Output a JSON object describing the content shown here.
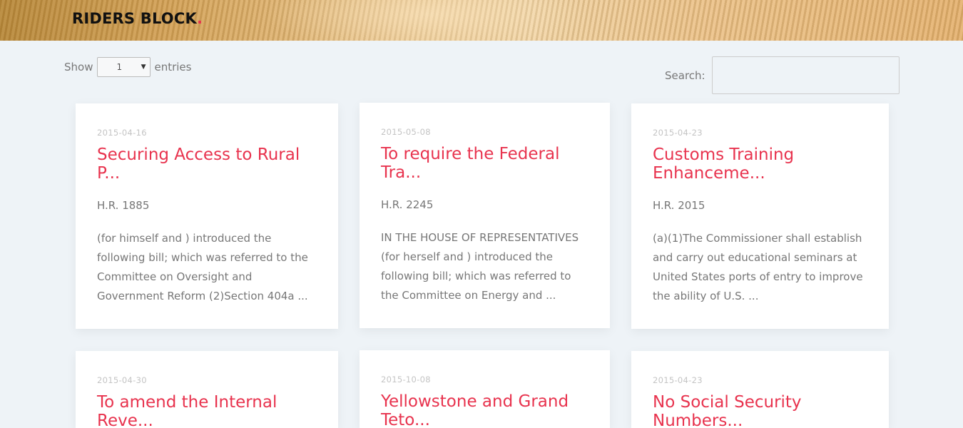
{
  "site": {
    "logo_text": "RIDERS BLOCK",
    "logo_dot": "."
  },
  "controls": {
    "show_label": "Show",
    "entries_value": "1",
    "entries_label": "entries",
    "search_label": "Search:",
    "search_value": ""
  },
  "cards": [
    {
      "date": "2015-04-16",
      "title": "Securing Access to Rural P...",
      "bill": "H.R. 1885",
      "excerpt": "(for himself and ) introduced the following bill; which was referred to the Committee on Oversight and Government Reform (2)Section 404a ..."
    },
    {
      "date": "2015-05-08",
      "title": "To require the Federal Tra...",
      "bill": "H.R. 2245",
      "excerpt": "IN THE HOUSE OF REPRESENTATIVES (for herself and ) introduced the following bill; which was referred to the Committee on Energy and ..."
    },
    {
      "date": "2015-04-23",
      "title": "Customs Training Enhanceme...",
      "bill": "H.R. 2015",
      "excerpt": "(a)(1)The Commissioner shall establish and carry out educational seminars at United States ports of entry to improve the ability of U.S. ..."
    },
    {
      "date": "2015-04-30",
      "title": "To amend the Internal Reve..."
    },
    {
      "date": "2015-10-08",
      "title": "Yellowstone and Grand Teto..."
    },
    {
      "date": "2015-04-23",
      "title": "No Social Security Numbers..."
    }
  ],
  "colors": {
    "accent": "#e8334e",
    "background": "#eef3f7",
    "card": "#ffffff"
  }
}
